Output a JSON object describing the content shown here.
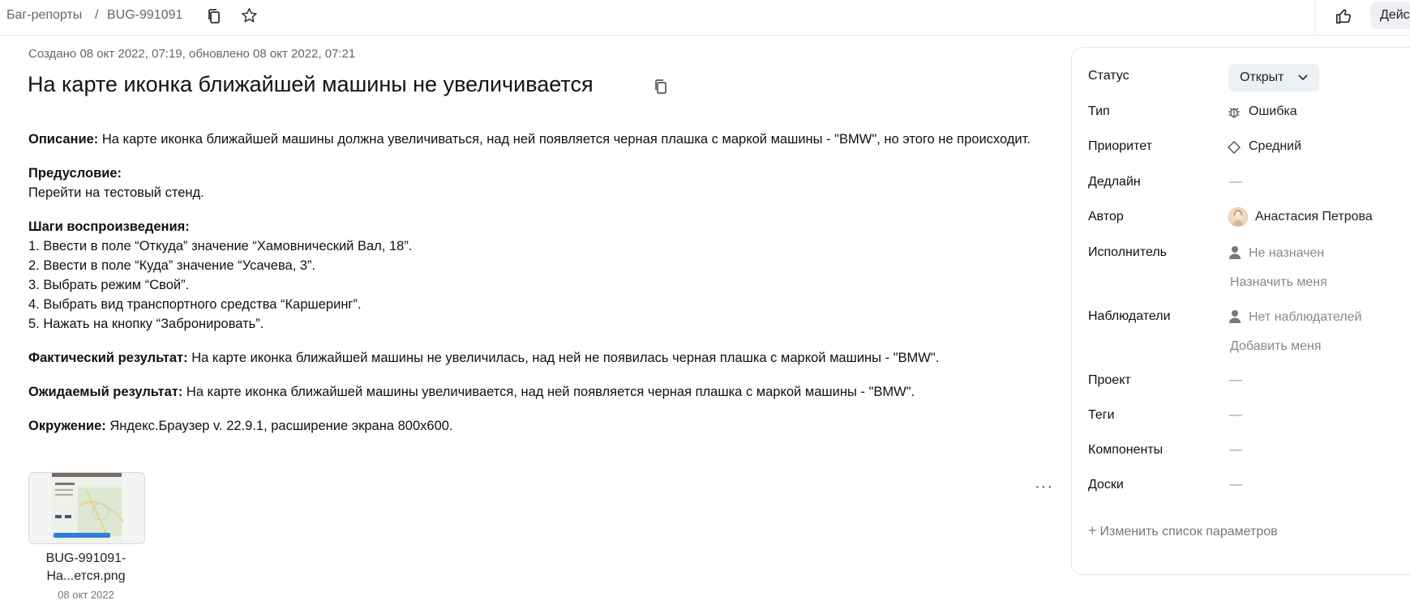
{
  "header": {
    "breadcrumb_parent": "Баг-репорты",
    "breadcrumb_sep": "/",
    "breadcrumb_current": "BUG-991091",
    "actions_label": "Дейс"
  },
  "issue": {
    "meta": "Создано 08 окт 2022, 07:19, обновлено 08 окт 2022, 07:21",
    "title": "На карте иконка ближайшей машины не увеличивается"
  },
  "description": {
    "desc_label": "Описание:",
    "desc_text": "На карте иконка ближайшей машины должна увеличиваться, над ней появляется черная плашка с маркой машины - \"BMW\", но этого не происходит.",
    "pre_label": "Предусловие:",
    "pre_text": "Перейти на тестовый стенд.",
    "steps_label": "Шаги воспроизведения:",
    "steps": [
      "1. Ввести в поле “Откуда” значение “Хамовнический Вал, 18”.",
      "2. Ввести в поле “Куда” значение “Усачева, 3”.",
      "3. Выбрать режим “Свой”.",
      "4. Выбрать вид транспортного средства “Каршеринг”.",
      "5. Нажать на кнопку “Забронировать”."
    ],
    "actual_label": "Фактический результат:",
    "actual_text": "На карте иконка ближайшей машины не увеличилась, над ней не появилась черная плашка с маркой машины - \"BMW\".",
    "expected_label": "Ожидаемый результат:",
    "expected_text": "На карте иконка ближайшей машины увеличивается, над ней появляется черная плашка с маркой машины - \"BMW\".",
    "env_label": "Окружение:",
    "env_text": "Яндекс.Браузер v. 22.9.1, расширение экрана 800x600."
  },
  "attachment": {
    "name_line1": "BUG-991091-",
    "name_line2": "На...ется.png",
    "date": "08 окт 2022",
    "more": "···"
  },
  "panel": {
    "status_label": "Статус",
    "status_value": "Открыт",
    "type_label": "Тип",
    "type_value": "Ошибка",
    "priority_label": "Приоритет",
    "priority_value": "Средний",
    "deadline_label": "Дедлайн",
    "empty": "—",
    "author_label": "Автор",
    "author_value": "Анастасия Петрова",
    "assignee_label": "Исполнитель",
    "assignee_value": "Не назначен",
    "assign_me": "Назначить меня",
    "watchers_label": "Наблюдатели",
    "watchers_value": "Нет наблюдателей",
    "add_me": "Добавить меня",
    "project_label": "Проект",
    "tags_label": "Теги",
    "components_label": "Компоненты",
    "boards_label": "Доски",
    "change_params": "Изменить список параметров"
  }
}
